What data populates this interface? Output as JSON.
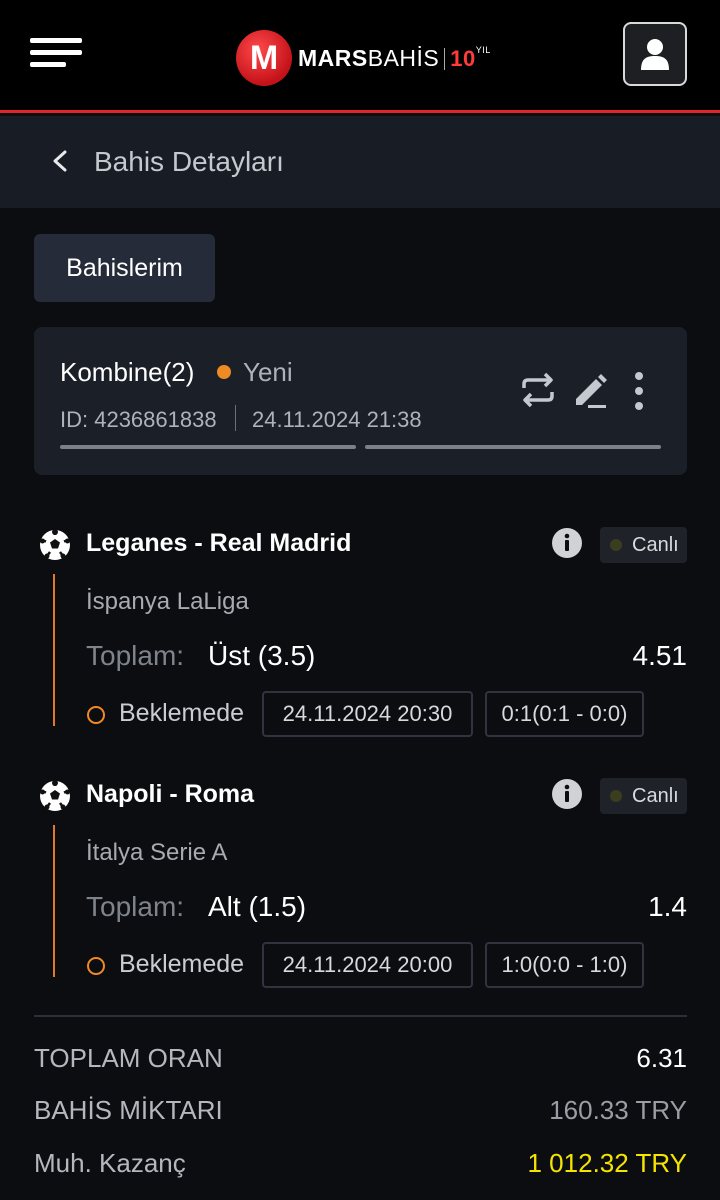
{
  "header": {
    "logo": {
      "mark": "M",
      "brand_bold": "MARS",
      "brand_thin": "BAHİS",
      "anniversary_number": "10",
      "anniversary_suffix": "YIL"
    }
  },
  "subheader": {
    "title": "Bahis Detayları"
  },
  "tabs": {
    "my_bets_label": "Bahislerim"
  },
  "bet_card": {
    "type": "Kombine(2)",
    "status": "Yeni",
    "status_color": "#f08a24",
    "id": "ID: 4236861838",
    "date": "24.11.2024 21:38"
  },
  "matches": [
    {
      "name": "Leganes - Real Madrid",
      "live_label": "Canlı",
      "league": "İspanya LaLiga",
      "market": "Toplam:",
      "selection": "Üst (3.5)",
      "odds": "4.51",
      "status": "Beklemede",
      "kickoff": "24.11.2024 20:30",
      "score": "0:1(0:1 - 0:0)"
    },
    {
      "name": "Napoli - Roma",
      "live_label": "Canlı",
      "league": "İtalya Serie A",
      "market": "Toplam:",
      "selection": "Alt (1.5)",
      "odds": "1.4",
      "status": "Beklemede",
      "kickoff": "24.11.2024 20:00",
      "score": "1:0(0:0 - 1:0)"
    }
  ],
  "summary": {
    "total_odds_label": "TOPLAM ORAN",
    "total_odds_value": "6.31",
    "stake_label": "BAHİS MİKTARI",
    "stake_value": "160.33 TRY",
    "potential_win_label": "Muh. Kazanç",
    "potential_win_value": "1 012.32 TRY",
    "potential_win_color": "#f5e400"
  },
  "colors": {
    "accent_red": "#e0262b",
    "pending_orange": "#f08a24"
  }
}
